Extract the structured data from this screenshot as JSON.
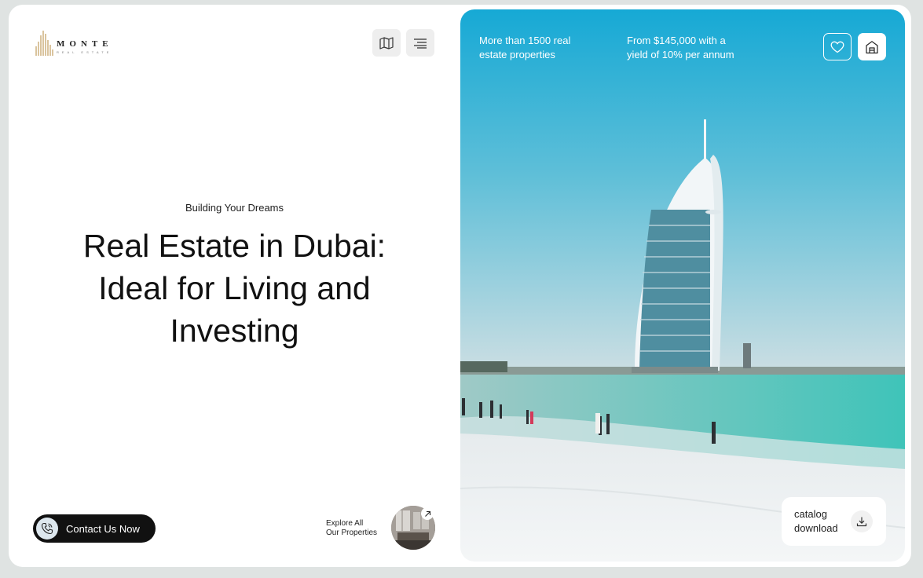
{
  "brand": {
    "name": "MONTE",
    "tagline": "REAL ESTATE"
  },
  "header": {
    "map_icon": "map-icon",
    "menu_icon": "menu-icon"
  },
  "hero": {
    "kicker": "Building Your Dreams",
    "title_line1": "Real Estate in Dubai:",
    "title_line2": "Ideal for Living and",
    "title_line3": "Investing"
  },
  "contact": {
    "label": "Contact Us Now",
    "icon": "phone-icon"
  },
  "explore": {
    "line1": "Explore All",
    "line2": "Our Properties",
    "icon": "arrow-up-right-icon"
  },
  "photo": {
    "stat1_line1": "More than 1500 real",
    "stat1_line2": "estate properties",
    "stat2_line1": "From $145,000 with a",
    "stat2_line2": "yield of 10% per annum",
    "favorite_icon": "heart-icon",
    "home_icon": "house-icon"
  },
  "catalog": {
    "line1": "catalog",
    "line2": "download",
    "icon": "download-icon"
  },
  "colors": {
    "accent_dark": "#111111",
    "sky": "#3fb3d6",
    "sea": "#4fc6c0",
    "sand": "#eef1f2"
  }
}
